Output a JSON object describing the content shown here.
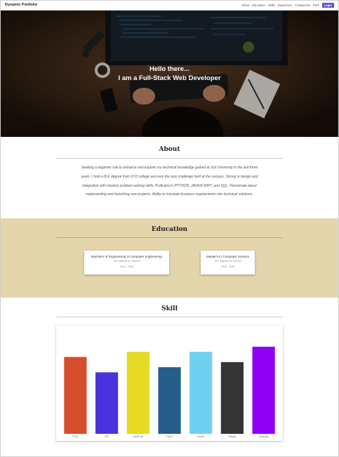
{
  "navbar": {
    "brand": "Dynamic Portfolio",
    "links": [
      "About",
      "Education",
      "Skills",
      "Experience",
      "Contact Me",
      "Print"
    ],
    "login_label": "Login"
  },
  "hero": {
    "greeting": "Hello there...",
    "role": "I am a Full-Stack Web Developer"
  },
  "about": {
    "title": "About",
    "text": "Seeking a beginner role to enhance and explore my technical knowledge gained at Xyz University in the last three years. I hold a B.E degree from XYZ college and won the quiz challenge held at the campus. Strong in design and integration with intuitive problem-solving skills. Proficient in PYTHON, JAVASCRIPT, and SQL. Passionate about implementing and launching new projects. Ability to translate business requirements into technical solutions."
  },
  "education": {
    "title": "Education",
    "cards": [
      {
        "degree": "Bachelor of Engineering in Computer engineering",
        "school": "TSS Institute for Science",
        "years": "2014 - 2018"
      },
      {
        "degree": "Master's in Computer Science",
        "school": "TSS Institute for Science",
        "years": "2018 - 2020"
      }
    ]
  },
  "skill": {
    "title": "Skill"
  },
  "chart_data": {
    "type": "bar",
    "categories": [
      "HTML",
      "CSS",
      "JavaScript",
      "Python",
      "Nodejs",
      "Reactjs",
      "Bootstrap"
    ],
    "values": [
      75,
      60,
      80,
      65,
      80,
      70,
      85
    ],
    "colors": [
      "#d64d2c",
      "#4a33de",
      "#e6da25",
      "#245d88",
      "#6ed1f1",
      "#353535",
      "#8e00f1"
    ],
    "title": "",
    "xlabel": "",
    "ylabel": "",
    "ylim": [
      0,
      100
    ]
  }
}
